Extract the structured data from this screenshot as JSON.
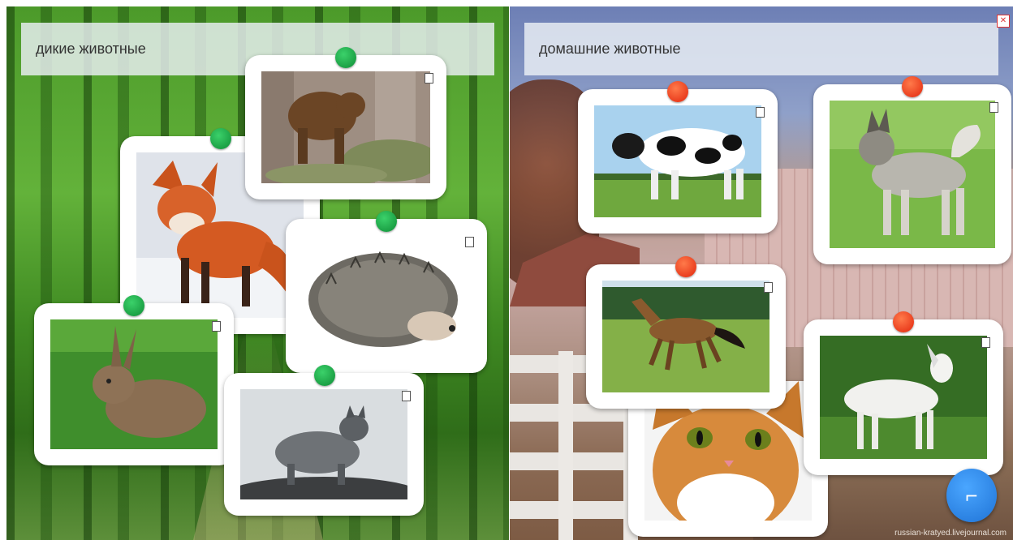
{
  "wild_group": {
    "label": "дикие животные",
    "pin_color": "#16a33f"
  },
  "domestic_group": {
    "label": "домашние животные",
    "pin_color": "#ef3a17"
  },
  "cards": {
    "bear": {
      "animal": "bear"
    },
    "fox": {
      "animal": "fox"
    },
    "hedgehog": {
      "animal": "hedgehog"
    },
    "hare": {
      "animal": "hare"
    },
    "wolf": {
      "animal": "wolf"
    },
    "cow": {
      "animal": "cow"
    },
    "dog": {
      "animal": "dog"
    },
    "horse": {
      "animal": "horse"
    },
    "goat": {
      "animal": "goat"
    },
    "cat": {
      "animal": "cat"
    }
  },
  "controls": {
    "next_icon": "corner-arrow-icon",
    "fullscreen_icon": "fullscreen-icon"
  },
  "watermark": "russian-kratyed.livejournal.com"
}
